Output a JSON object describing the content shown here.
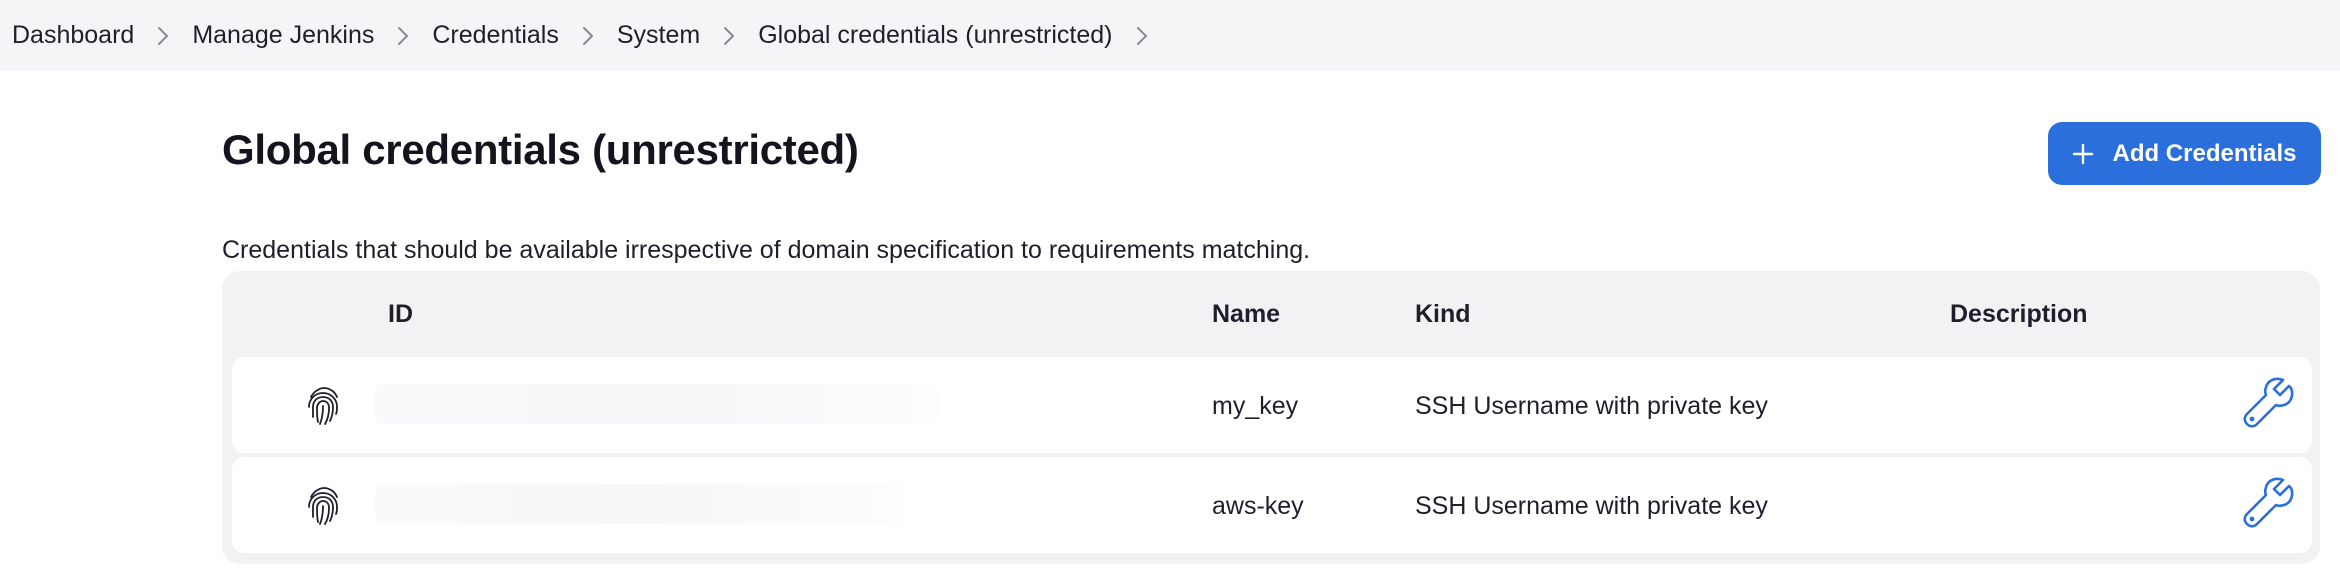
{
  "breadcrumb": {
    "items": [
      {
        "label": "Dashboard"
      },
      {
        "label": "Manage Jenkins"
      },
      {
        "label": "Credentials"
      },
      {
        "label": "System"
      },
      {
        "label": "Global credentials (unrestricted)"
      }
    ]
  },
  "page": {
    "title": "Global credentials (unrestricted)",
    "description": "Credentials that should be available irrespective of domain specification to requirements matching."
  },
  "actions": {
    "add_credentials_label": "Add Credentials",
    "add_icon": "plus-icon"
  },
  "table": {
    "columns": [
      "ID",
      "Name",
      "Kind",
      "Description"
    ],
    "rows": [
      {
        "id": "",
        "name": "my_key",
        "kind": "SSH Username with private key",
        "description": "",
        "icon": "fingerprint-icon",
        "action_icon": "wrench-icon"
      },
      {
        "id": "",
        "name": "aws-key",
        "kind": "SSH Username with private key",
        "description": "",
        "icon": "fingerprint-icon",
        "action_icon": "wrench-icon"
      }
    ]
  },
  "colors": {
    "accent": "#2a6fdb",
    "breadcrumb_bg": "#f5f5f7",
    "table_bg": "#f2f2f4"
  }
}
